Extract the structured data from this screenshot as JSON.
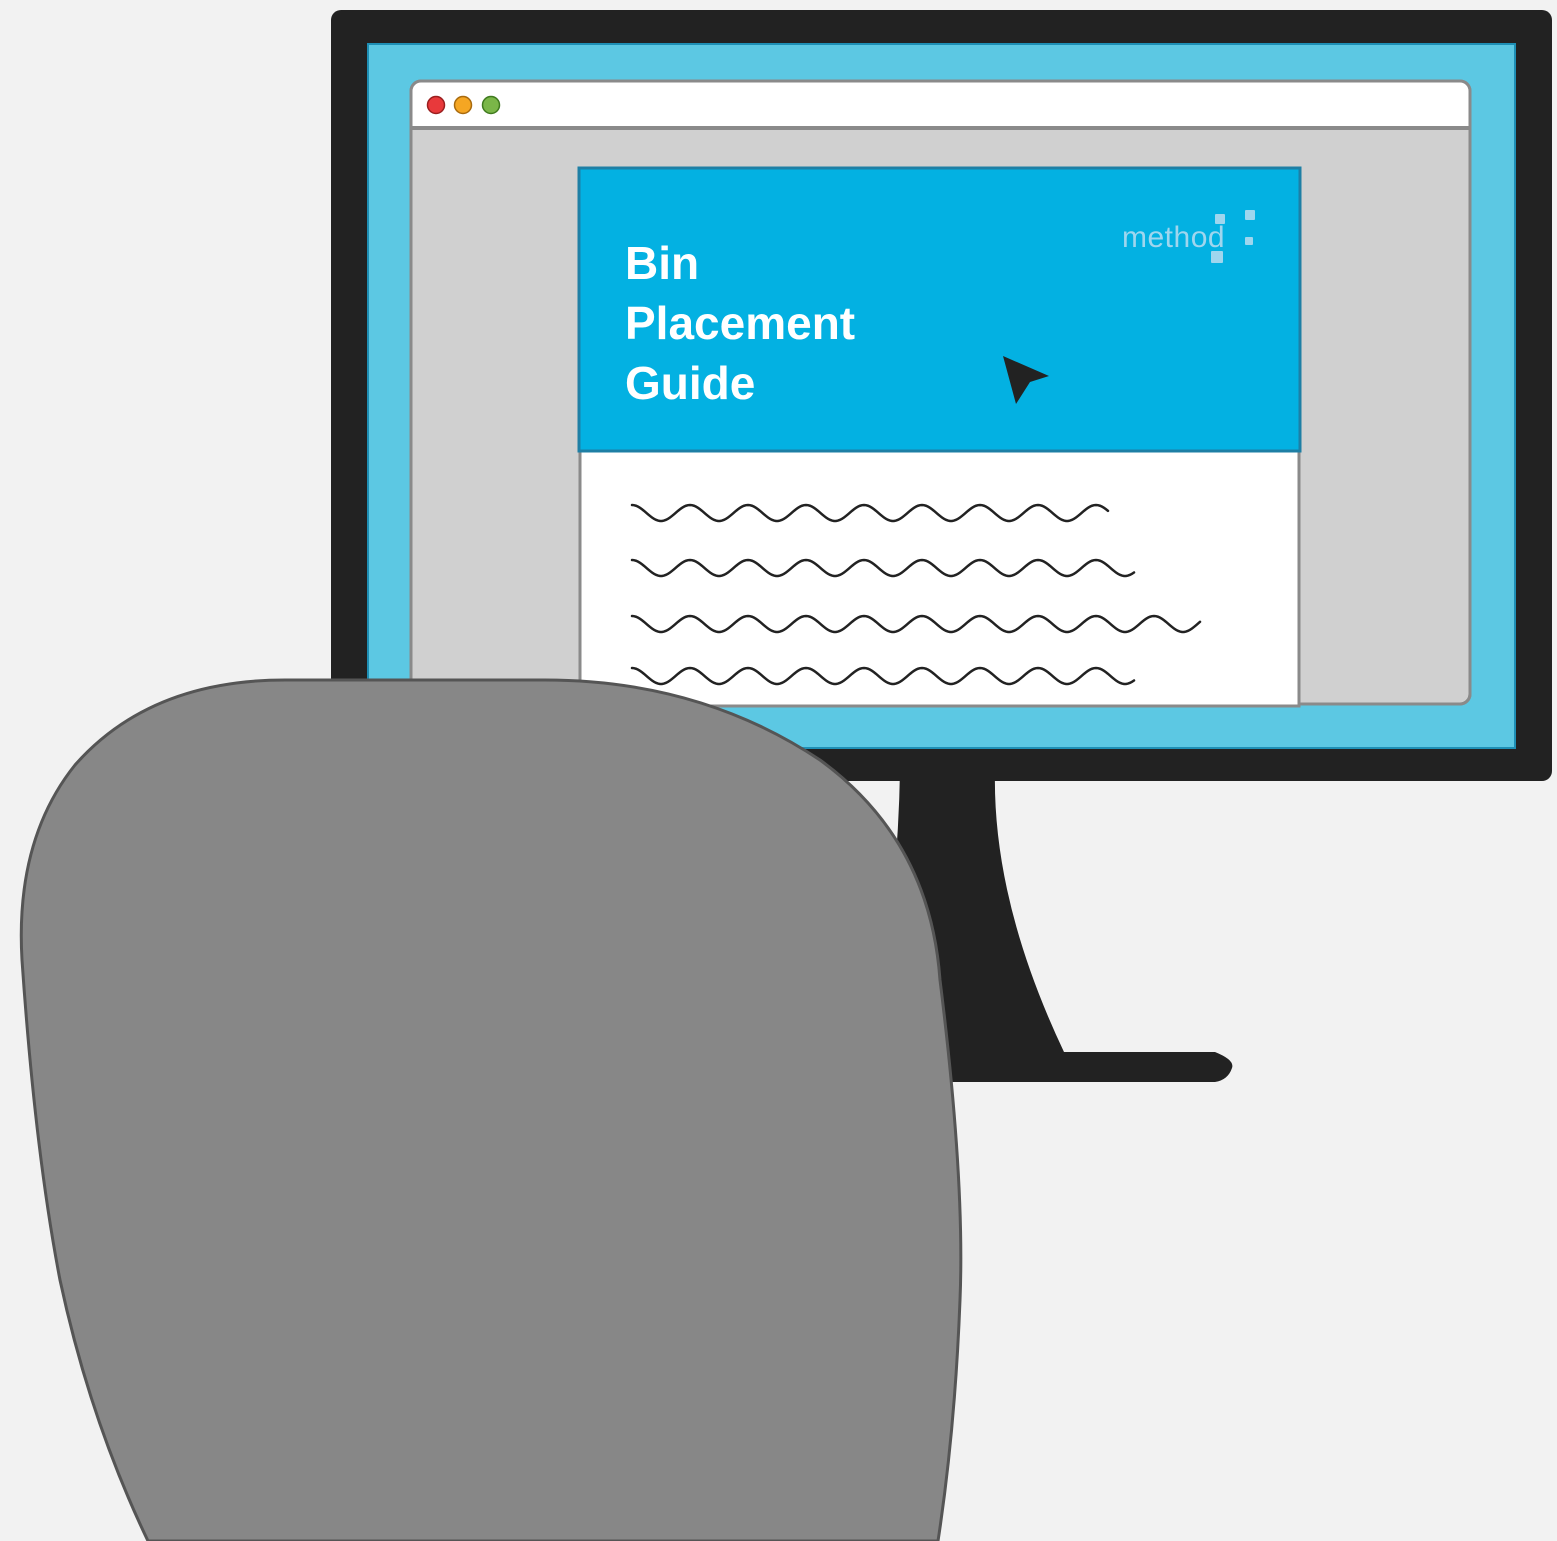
{
  "document": {
    "title_lines": [
      "Bin",
      "Placement",
      "Guide"
    ],
    "logo_text": "method"
  },
  "browser": {
    "window_controls": [
      "close-icon",
      "minimize-icon",
      "maximize-icon"
    ]
  },
  "colors": {
    "background": "#f2f2f2",
    "monitor_bezel": "#222222",
    "screen": "#5cc8e3",
    "browser_viewport": "#d0d0d0",
    "document_header": "#03b1e2",
    "document_body": "#ffffff",
    "close": "#e8393b",
    "minimize": "#f5a623",
    "maximize": "#7ab648",
    "person_head": "#878787",
    "logo": "#9fd6ee",
    "cursor": "#222222"
  }
}
